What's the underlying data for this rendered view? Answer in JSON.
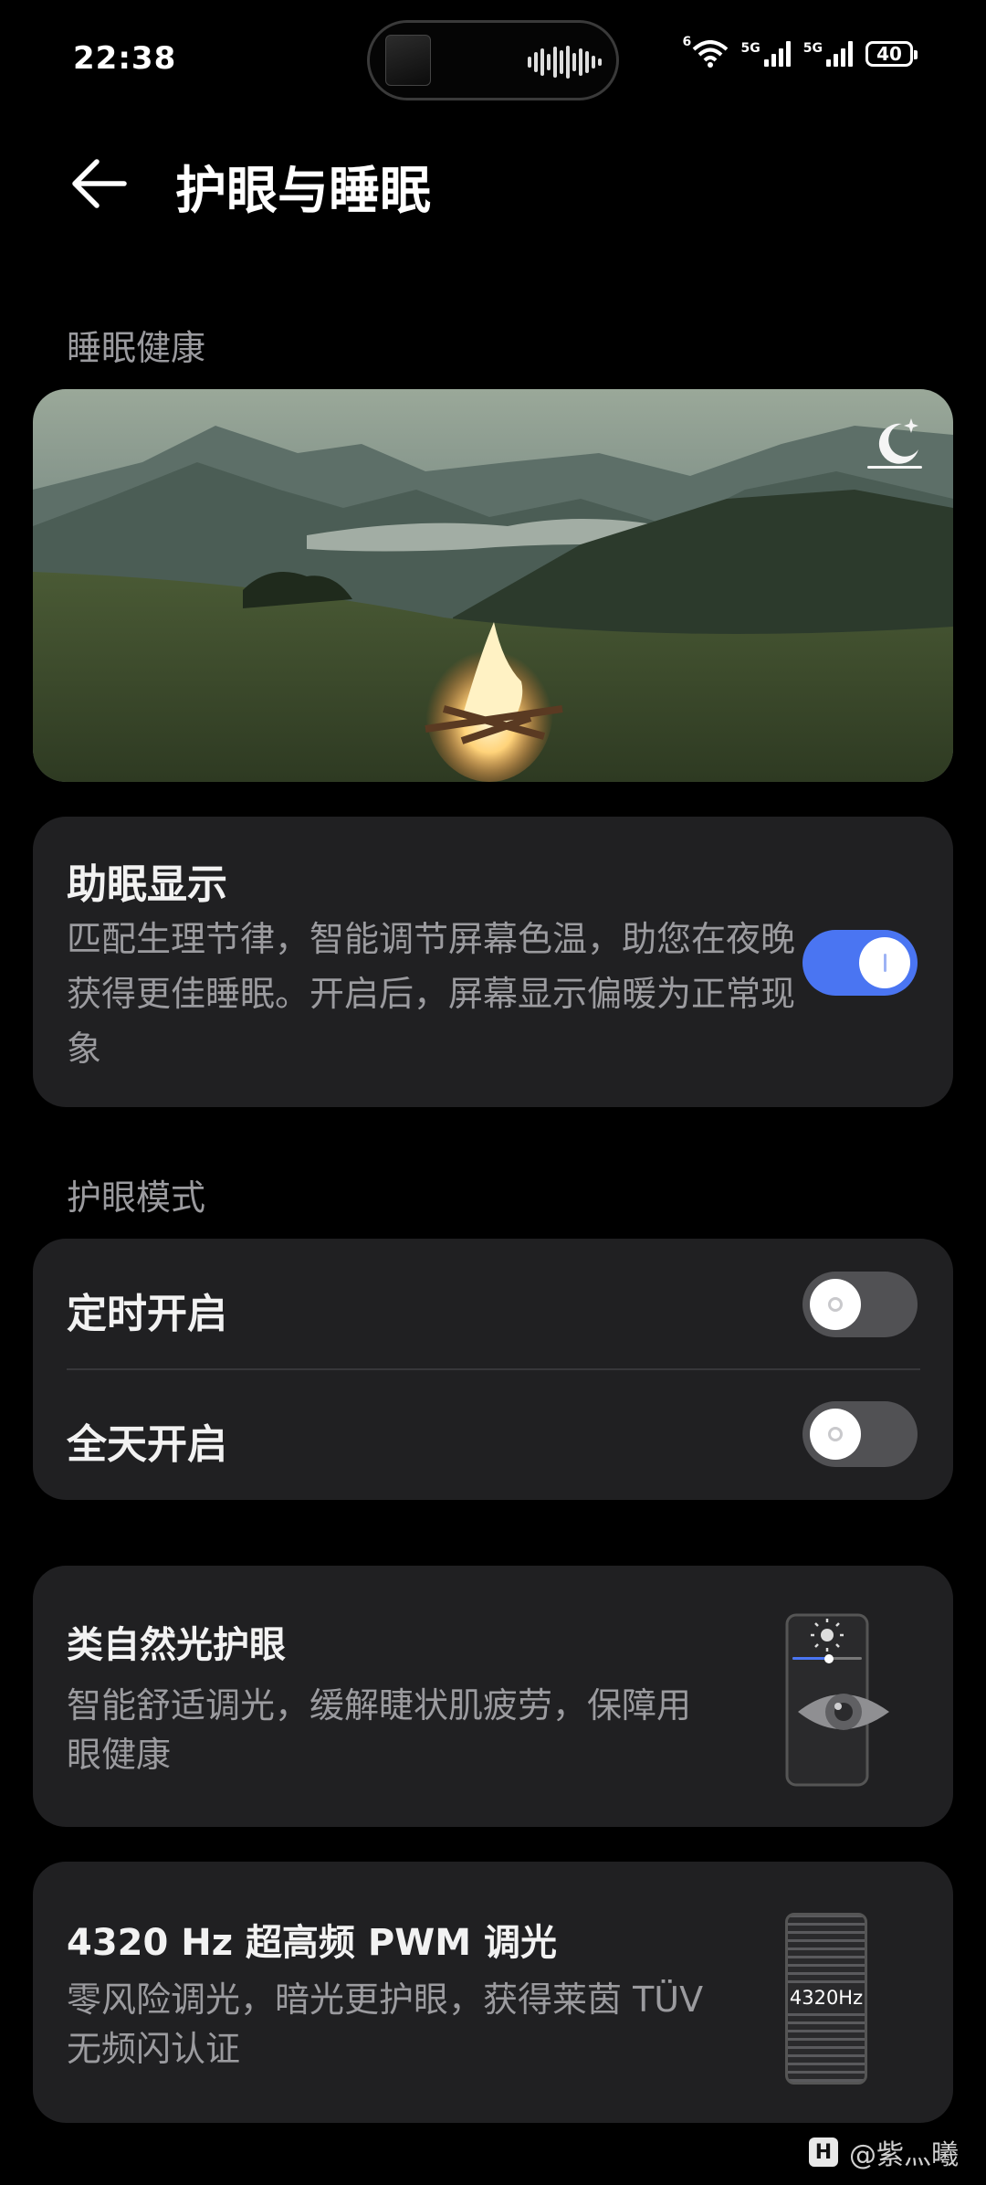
{
  "status_bar": {
    "time": "22:38",
    "network_1": "6",
    "network_2": "5G",
    "network_3": "5G",
    "battery": "40"
  },
  "header": {
    "title": "护眼与睡眠",
    "back_icon": "back-arrow-icon"
  },
  "sleep_section": {
    "heading": "睡眠健康",
    "hero_icon": "moon-stars-icon",
    "assist": {
      "title": "助眠显示",
      "desc": "匹配生理节律，智能调节屏幕色温，助您在夜晚获得更佳睡眠。开启后，屏幕显示偏暖为正常现象",
      "enabled": true
    }
  },
  "eye_section": {
    "heading": "护眼模式",
    "items": [
      {
        "label": "定时开启",
        "enabled": false
      },
      {
        "label": "全天开启",
        "enabled": false
      }
    ]
  },
  "natural_light": {
    "title": "类自然光护眼",
    "desc": "智能舒适调光，缓解睫状肌疲劳，保障用眼健康",
    "icon": "eye-brightness-icon"
  },
  "pwm": {
    "title": "4320 Hz 超高频 PWM 调光",
    "desc": "零风险调光，暗光更护眼，获得莱茵 TÜV 无频闪认证",
    "badge": "4320Hz"
  },
  "watermark": {
    "logo": "H",
    "text": "@紫灬曦"
  },
  "colors": {
    "accent": "#4a75f2",
    "card": "#202022",
    "background": "#000000"
  }
}
